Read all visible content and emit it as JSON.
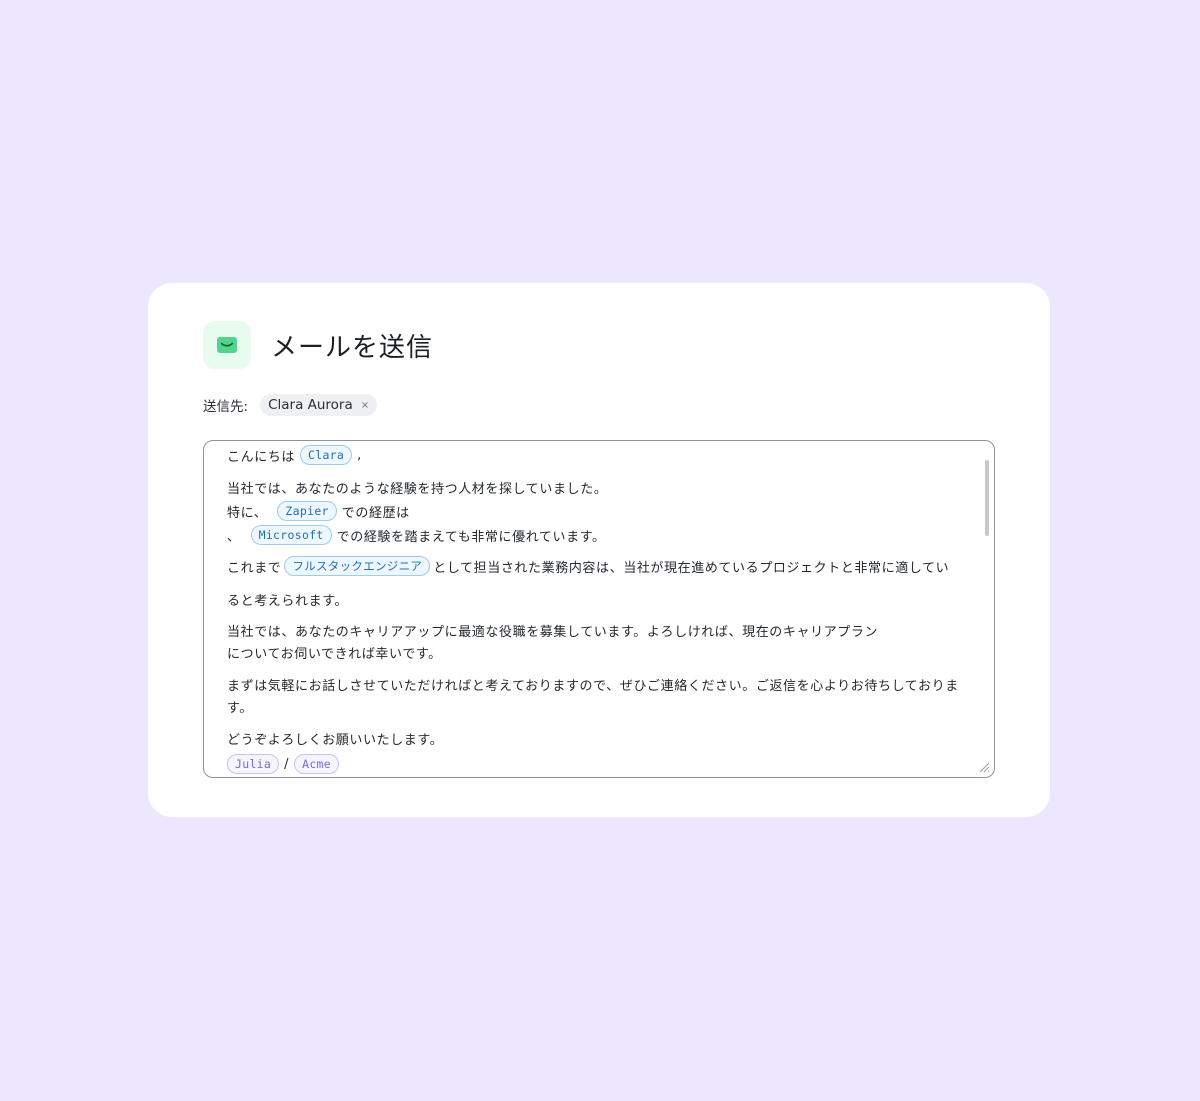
{
  "dialog": {
    "title": "メールを送信",
    "icon": "mail-icon",
    "accent_color": "#4fd189"
  },
  "recipients": {
    "label": "送信先:",
    "chips": [
      {
        "name": "Clara Aurora",
        "remove_label": "×"
      }
    ]
  },
  "body": {
    "greeting_prefix": "こんにちは",
    "greeting_var": "Clara",
    "greeting_suffix": ",",
    "p1_line1": "当社では、あなたのような経験を持つ人材を探していました。",
    "p1_line2_prefix": "特に、",
    "p1_line2_var": "Zapier",
    "p1_line2_suffix": "での経歴は",
    "p1_line3_prefix": "、",
    "p1_line3_var": "Microsoft",
    "p1_line3_suffix": "での経験を踏まえても非常に優れています。",
    "p2_line1_prefix": "これまで",
    "p2_line1_var": "フルスタックエンジニア",
    "p2_line1_suffix": "として担当された業務内容は、当社が現在進めているプロジェクトと非常に適してい",
    "p2_line2": "ると考えられます。",
    "p3_line1": "当社では、あなたのキャリアアップに最適な役職を募集しています。よろしければ、現在のキャリアプラン",
    "p3_line2": "についてお伺いできれば幸いです。",
    "p4_line1": "まずは気軽にお話しさせていただければと考えておりますので、ぜひご連絡ください。ご返信を心よりお待ちしておりま",
    "p4_line2": "す。",
    "closing": "どうぞよろしくお願いいたします。",
    "sign_var_name": "Julia",
    "sign_separator": "/",
    "sign_var_company": "Acme"
  }
}
